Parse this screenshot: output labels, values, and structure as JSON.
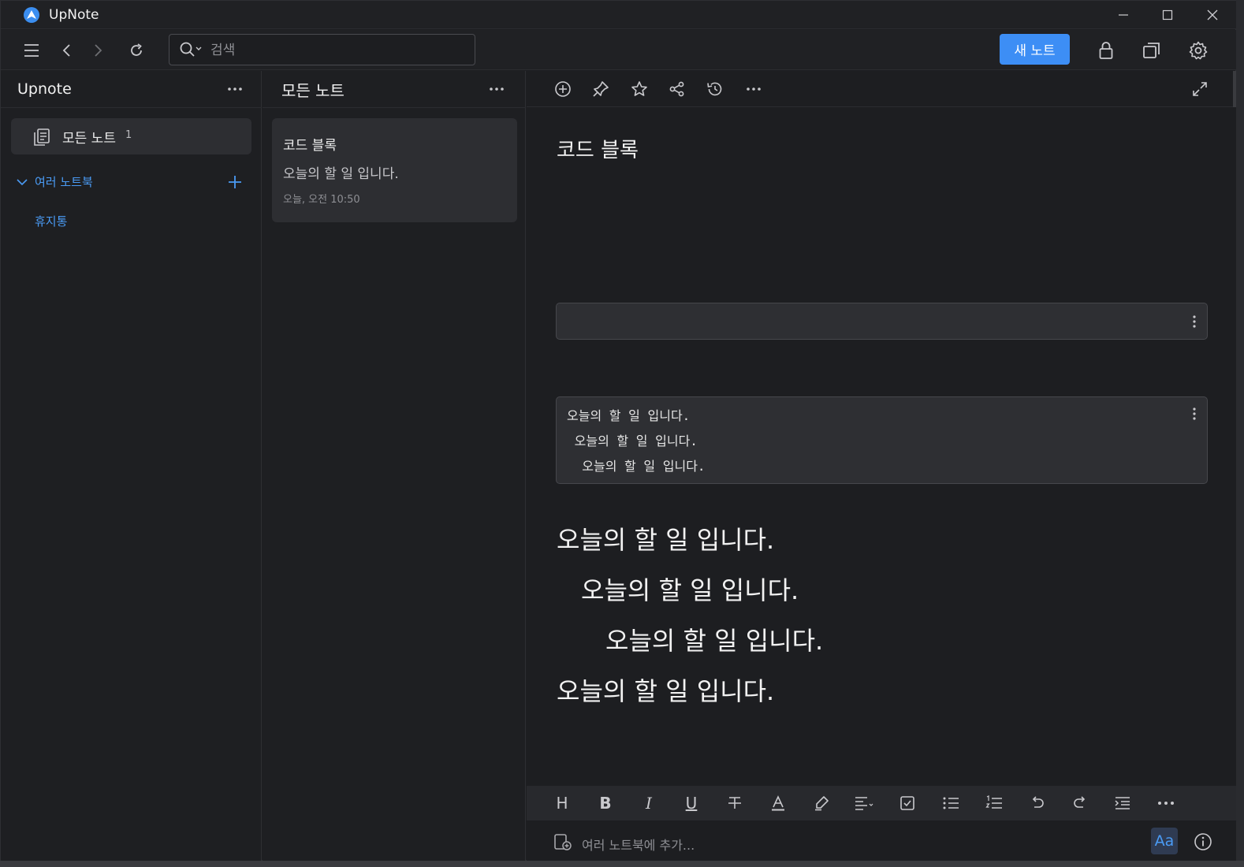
{
  "app": {
    "title": "UpNote",
    "accent": "#3d8ef5"
  },
  "toolbar": {
    "search_placeholder": "검색",
    "new_note_label": "새 노트"
  },
  "sidebar": {
    "title": "Upnote",
    "all_notes_label": "모든 노트",
    "all_notes_count": "1",
    "notebooks_label": "여러 노트북",
    "trash_label": "휴지통"
  },
  "notelist": {
    "title": "모든 노트",
    "notes": [
      {
        "title": "코드 블록",
        "preview": "오늘의 할 일 입니다.",
        "date": "오늘, 오전 10:50"
      }
    ]
  },
  "editor": {
    "title": "코드 블록",
    "code_block_lines": [
      "오늘의 할 일 입니다.",
      " 오늘의 할 일 입니다.",
      "  오늘의 할 일 입니다."
    ],
    "body_lines": [
      "오늘의 할 일 입니다.",
      "오늘의 할 일 입니다.",
      "오늘의 할 일 입니다.",
      "오늘의 할 일 입니다."
    ],
    "format_heading": "H",
    "format_bold": "B",
    "format_italic": "I",
    "format_underline": "U",
    "footer_placeholder": "여러 노트북에 추가...",
    "font_button_label": "Aa"
  },
  "icons": [
    "menu-icon",
    "back-icon",
    "forward-icon",
    "refresh-icon",
    "search-icon",
    "lock-icon",
    "copy-window-icon",
    "gear-icon",
    "more-icon",
    "notes-icon",
    "chevron-down-icon",
    "plus-icon",
    "add-circle-icon",
    "pin-icon",
    "star-icon",
    "share-icon",
    "history-icon",
    "expand-icon",
    "info-icon"
  ]
}
